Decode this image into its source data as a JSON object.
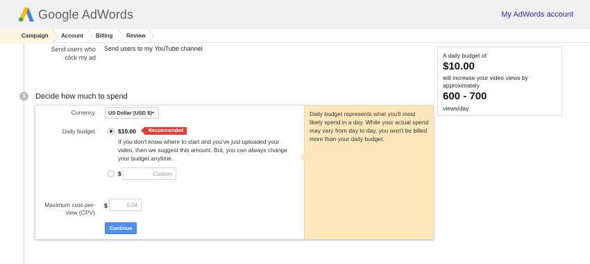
{
  "header": {
    "brand": "Google AdWords",
    "account_link": "My AdWords account"
  },
  "steps": [
    "Campaign",
    "Account",
    "Billing",
    "Review"
  ],
  "send_users": {
    "label": "Send users who click my ad",
    "value": "Send users to my YouTube channel"
  },
  "section": {
    "number": "3",
    "title": "Decide how much to spend"
  },
  "form": {
    "currency_label": "Currency",
    "currency_value": "US Dollar (USD $)",
    "daily_budget_label": "Daily budget",
    "recommended_amount": "$10.00",
    "recommended_badge": "Recommended",
    "budget_note": "If you don't know where to start and you've just uploaded your video, then we suggest this amount. But, you can always change your budget anytime.",
    "currency_symbol": "$",
    "custom_placeholder": "Custom",
    "max_cpv_label": "Maximum cost-per-view (CPV)",
    "max_cpv_placeholder": "0.04",
    "continue_label": "Continue"
  },
  "help": {
    "text": "Daily budget represents what you'll most likely spend in a day. While your actual spend may vary from day to day, you won't be billed more than your daily budget."
  },
  "estimate": {
    "line1": "A daily budget of",
    "budget": "$10.00",
    "line2": "will increase your video views by approximately",
    "views": "600 - 700",
    "unit": "views/day"
  },
  "colors": {
    "accent_blue": "#4d8ff0",
    "badge_red": "#d9423a",
    "help_bg": "#fee8ba",
    "account_link": "#3523b8"
  }
}
